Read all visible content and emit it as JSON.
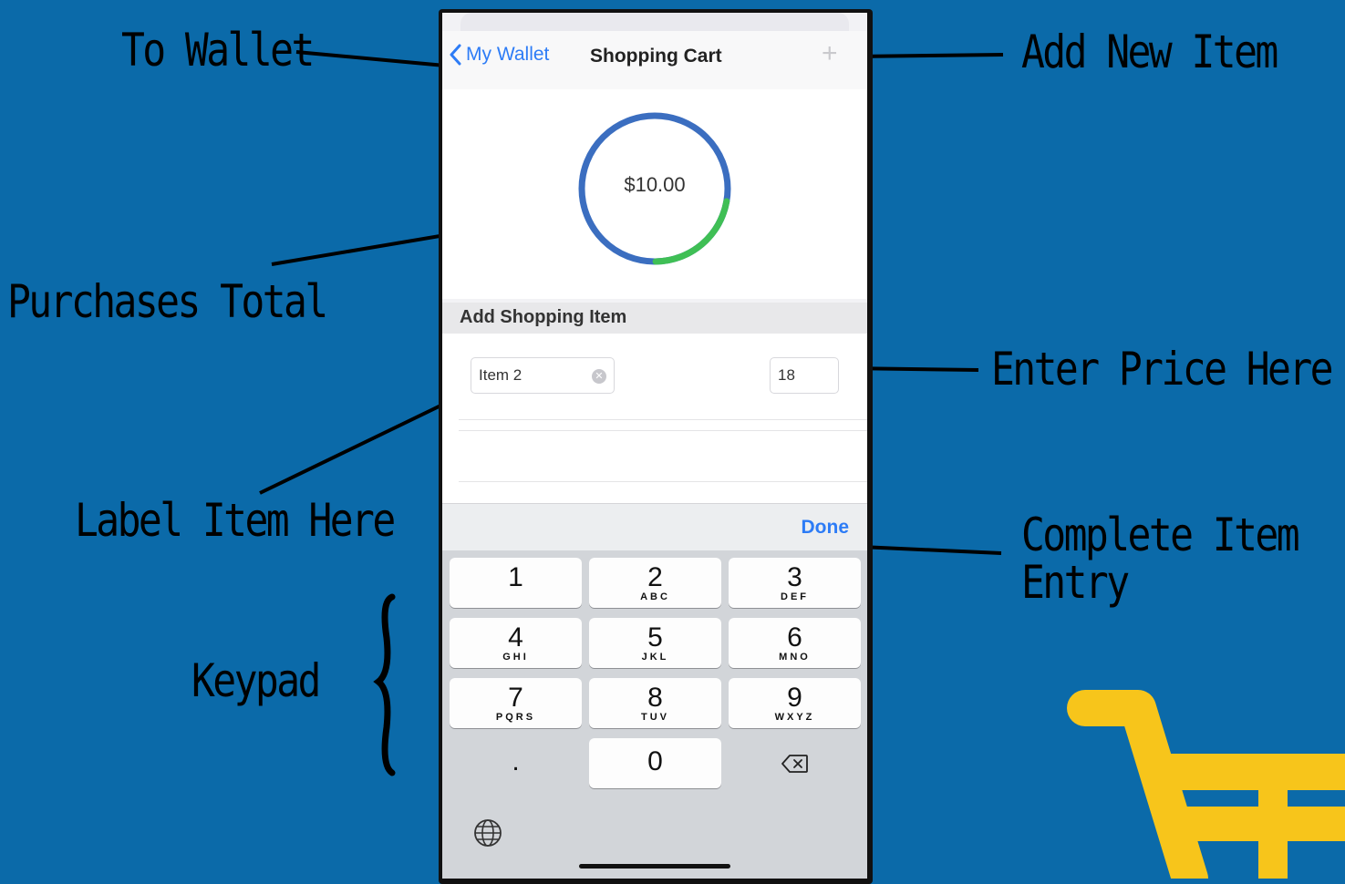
{
  "annotations": {
    "to_wallet": "To Wallet",
    "add_new_item": "Add New Item",
    "purchases_total": "Purchases Total",
    "enter_price_here": "Enter Price Here",
    "label_item_here": "Label Item Here",
    "complete_item_entry_line1": "Complete Item",
    "complete_item_entry_line2": "Entry",
    "keypad": "Keypad"
  },
  "navbar": {
    "back_label": "My Wallet",
    "title": "Shopping Cart",
    "add_icon": "plus-icon"
  },
  "total": {
    "amount": "$10.00",
    "progress_fraction": 0.22
  },
  "section": {
    "header": "Add Shopping Item"
  },
  "form": {
    "item_name_value": "Item 2",
    "price_value": "18"
  },
  "accessory": {
    "done_label": "Done"
  },
  "keypad": {
    "keys": [
      {
        "num": "1",
        "letters": ""
      },
      {
        "num": "2",
        "letters": "ABC"
      },
      {
        "num": "3",
        "letters": "DEF"
      },
      {
        "num": "4",
        "letters": "GHI"
      },
      {
        "num": "5",
        "letters": "JKL"
      },
      {
        "num": "6",
        "letters": "MNO"
      },
      {
        "num": "7",
        "letters": "PQRS"
      },
      {
        "num": "8",
        "letters": "TUV"
      },
      {
        "num": "9",
        "letters": "WXYZ"
      },
      {
        "num": ".",
        "letters": ""
      },
      {
        "num": "0",
        "letters": ""
      }
    ]
  },
  "colors": {
    "background": "#0b6aa9",
    "ring": "#3b6ec0",
    "ring_progress": "#3fbf55",
    "ios_blue": "#2d7cf6",
    "cart": "#f7c51b"
  }
}
